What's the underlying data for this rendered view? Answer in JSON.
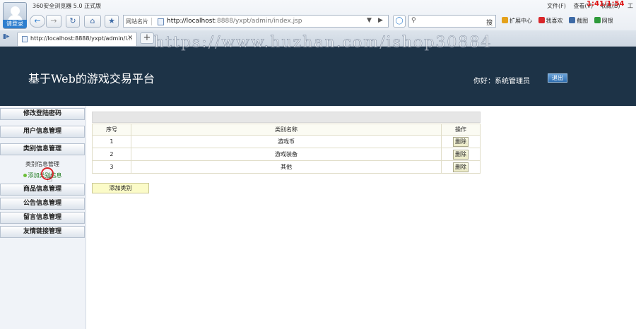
{
  "browser": {
    "login_label": "请登录",
    "title": "360安全浏览器 5.0 正式版",
    "menu": [
      "文件(F)",
      "查看(V)",
      "收藏(B)",
      "工"
    ],
    "clock": "1:41/1:54",
    "addr_label": "网站名片",
    "url_host": "http://localhost",
    "url_rest": ":8888/yxpt/admin/index.jsp",
    "search_button": "搜",
    "toolbar_items": [
      {
        "label": "扩展中心",
        "color": "#e4a11b"
      },
      {
        "label": "我喜欢",
        "color": "#d9262a"
      },
      {
        "label": "截图",
        "color": "#3d6aa6"
      },
      {
        "label": "网银",
        "color": "#2e9a3a"
      }
    ],
    "tab_title": "http://localhost:8888/yxpt/admin/i..."
  },
  "watermark": "https://www.huzhan.com/ishop30884",
  "header": {
    "title": "基于Web的游戏交易平台",
    "greeting": "你好：系统管理员",
    "logout_label": "退出"
  },
  "menu": {
    "change_password": "修改登陆密码",
    "user_management": "用户信息管理",
    "category_management": "类别信息管理",
    "category_sub_manage": "类别信息管理",
    "category_sub_add": "添加类别信息",
    "product_management": "商品信息管理",
    "notice_management": "公告信息管理",
    "message_management": "留言信息管理",
    "link_management": "友情链接管理"
  },
  "table": {
    "headers": {
      "index": "序号",
      "name": "类别名称",
      "action": "操作"
    },
    "rows": [
      {
        "index": "1",
        "name": "游戏币",
        "action": "删除"
      },
      {
        "index": "2",
        "name": "游戏装备",
        "action": "删除"
      },
      {
        "index": "3",
        "name": "其他",
        "action": "删除"
      }
    ]
  },
  "add_category_label": "添加类别"
}
